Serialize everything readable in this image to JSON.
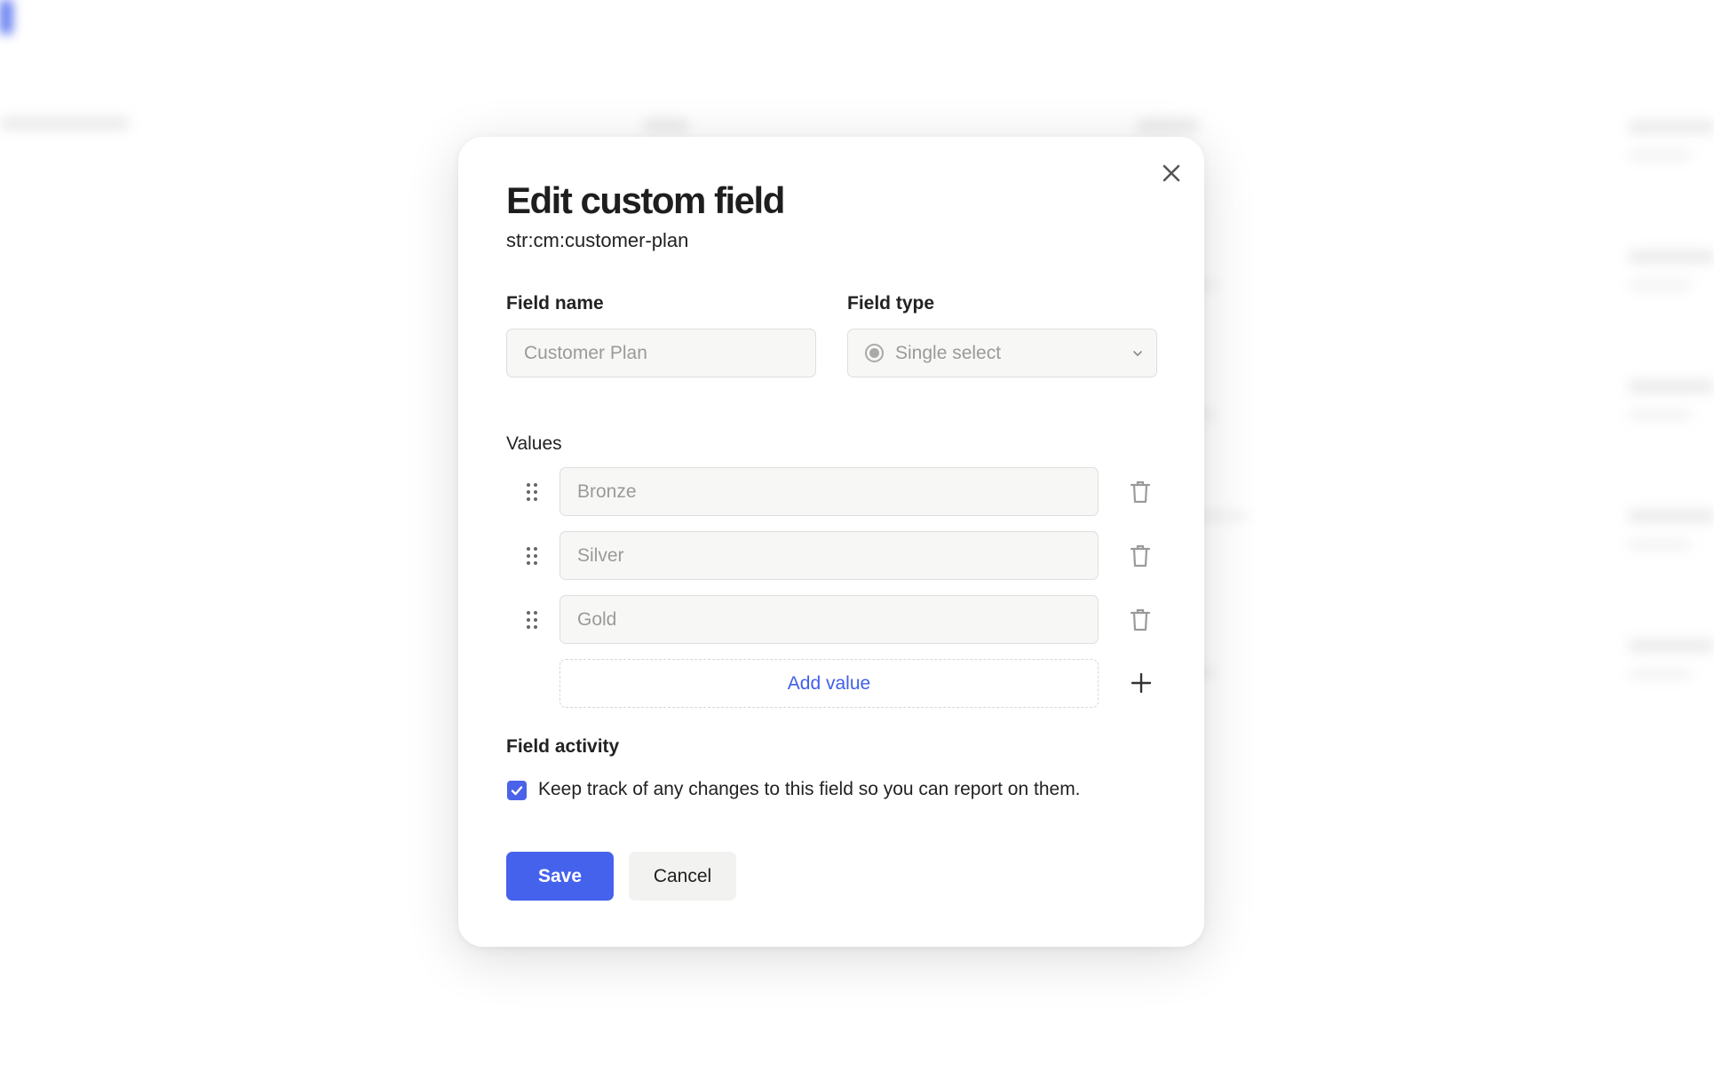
{
  "dialog": {
    "title": "Edit custom field",
    "subtitle": "str:cm:customer-plan",
    "close_icon": "close-icon"
  },
  "field_name": {
    "label": "Field name",
    "value": "Customer Plan"
  },
  "field_type": {
    "label": "Field type",
    "value": "Single select",
    "icon": "radio-icon",
    "dropdown_icon": "chevron-down-icon"
  },
  "values": {
    "label": "Values",
    "items": [
      {
        "label": "Bronze"
      },
      {
        "label": "Silver"
      },
      {
        "label": "Gold"
      }
    ],
    "add_label": "Add value"
  },
  "field_activity": {
    "label": "Field activity",
    "checkbox_label": "Keep track of any changes to this field so you can report on them.",
    "checked": true
  },
  "actions": {
    "save_label": "Save",
    "cancel_label": "Cancel"
  },
  "colors": {
    "accent": "#4562ec",
    "link": "#3f5fe8",
    "input_bg": "#f7f7f6",
    "input_border": "#dedede"
  }
}
